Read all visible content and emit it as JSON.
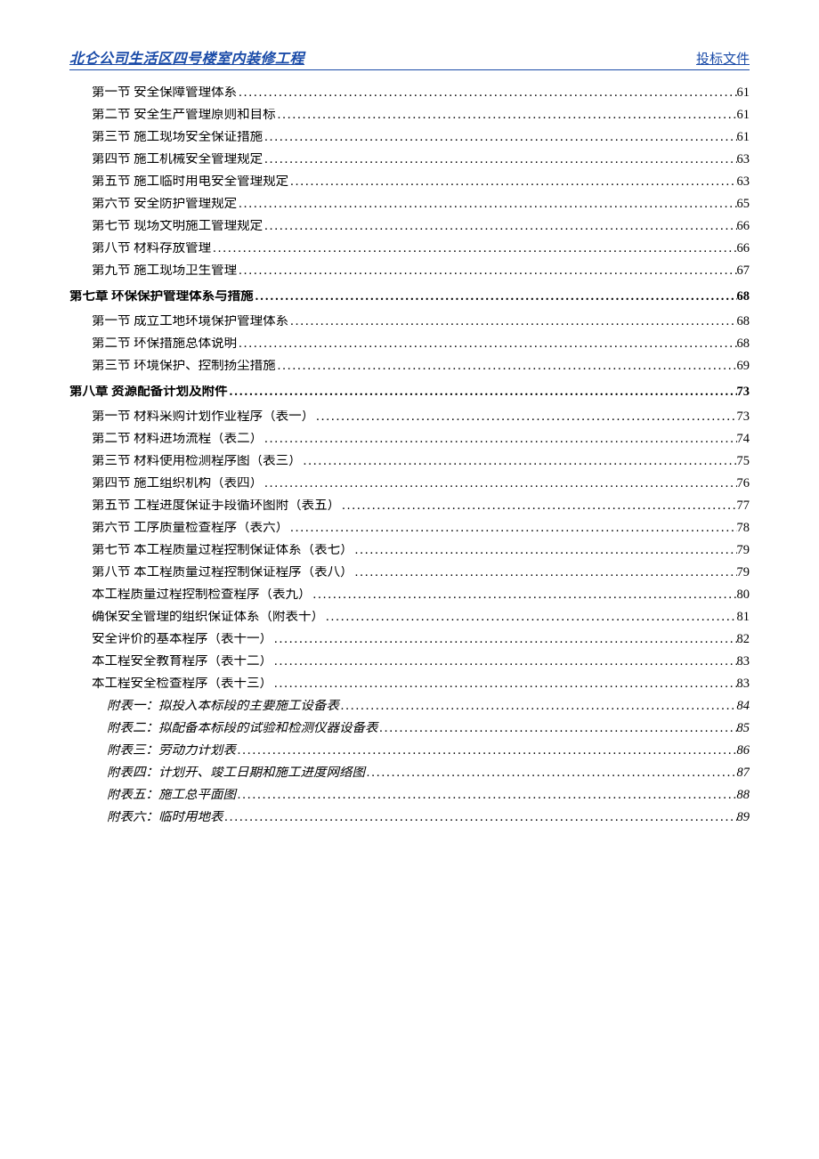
{
  "header": {
    "left": "北仑公司生活区四号楼室内装修工程",
    "right": "投标文件"
  },
  "toc": [
    {
      "type": "section",
      "label": "第一节 安全保障管理体系",
      "page": "61"
    },
    {
      "type": "section",
      "label": "第二节 安全生产管理原则和目标",
      "page": "61"
    },
    {
      "type": "section",
      "label": "第三节 施工现场安全保证措施",
      "page": "61"
    },
    {
      "type": "section",
      "label": "第四节 施工机械安全管理规定",
      "page": "63"
    },
    {
      "type": "section",
      "label": "第五节 施工临时用电安全管理规定",
      "page": "63"
    },
    {
      "type": "section",
      "label": "第六节 安全防护管理规定",
      "page": "65"
    },
    {
      "type": "section",
      "label": "第七节 现场文明施工管理规定",
      "page": "66"
    },
    {
      "type": "section",
      "label": "第八节 材料存放管理",
      "page": "66"
    },
    {
      "type": "section",
      "label": "第九节 施工现场卫生管理",
      "page": "67"
    },
    {
      "type": "chapter",
      "label": "第七章 环保保护管理体系与措施",
      "page": "68"
    },
    {
      "type": "section",
      "label": "第一节 成立工地环境保护管理体系",
      "page": "68"
    },
    {
      "type": "section",
      "label": "第二节 环保措施总体说明",
      "page": "68"
    },
    {
      "type": "section",
      "label": "第三节 环境保护、控制扬尘措施",
      "page": "69"
    },
    {
      "type": "chapter",
      "label": "第八章 资源配备计划及附件",
      "page": "73"
    },
    {
      "type": "section",
      "label": "第一节 材料采购计划作业程序（表一）",
      "page": "73"
    },
    {
      "type": "section",
      "label": "第二节 材料进场流程（表二）",
      "page": "74"
    },
    {
      "type": "section",
      "label": "第三节 材料使用检测程序图（表三）",
      "page": "75"
    },
    {
      "type": "section",
      "label": "第四节 施工组织机构（表四）",
      "page": "76"
    },
    {
      "type": "section",
      "label": "第五节 工程进度保证手段循环图附（表五）",
      "page": "77"
    },
    {
      "type": "section",
      "label": "第六节 工序质量检查程序（表六）",
      "page": "78"
    },
    {
      "type": "section",
      "label": "第七节 本工程质量过程控制保证体系（表七）",
      "page": "79"
    },
    {
      "type": "section",
      "label": "第八节 本工程质量过程控制保证程序（表八）",
      "page": "79"
    },
    {
      "type": "section",
      "label": "本工程质量过程控制检查程序（表九）",
      "page": "80"
    },
    {
      "type": "section",
      "label": "确保安全管理的组织保证体系（附表十）",
      "page": "81"
    },
    {
      "type": "section",
      "label": "安全评价的基本程序（表十一）",
      "page": "82"
    },
    {
      "type": "section",
      "label": "本工程安全教育程序（表十二）",
      "page": "83"
    },
    {
      "type": "section",
      "label": "本工程安全检查程序（表十三）",
      "page": "83"
    },
    {
      "type": "appendix",
      "label": "附表一：拟投入本标段的主要施工设备表",
      "page": "84"
    },
    {
      "type": "appendix",
      "label": "附表二：拟配备本标段的试验和检测仪器设备表",
      "page": "85"
    },
    {
      "type": "appendix",
      "label": "附表三：劳动力计划表",
      "page": "86"
    },
    {
      "type": "appendix",
      "label": "附表四：计划开、竣工日期和施工进度网络图",
      "page": "87"
    },
    {
      "type": "appendix",
      "label": "附表五：施工总平面图",
      "page": "88"
    },
    {
      "type": "appendix",
      "label": "附表六：临时用地表",
      "page": "89"
    }
  ]
}
